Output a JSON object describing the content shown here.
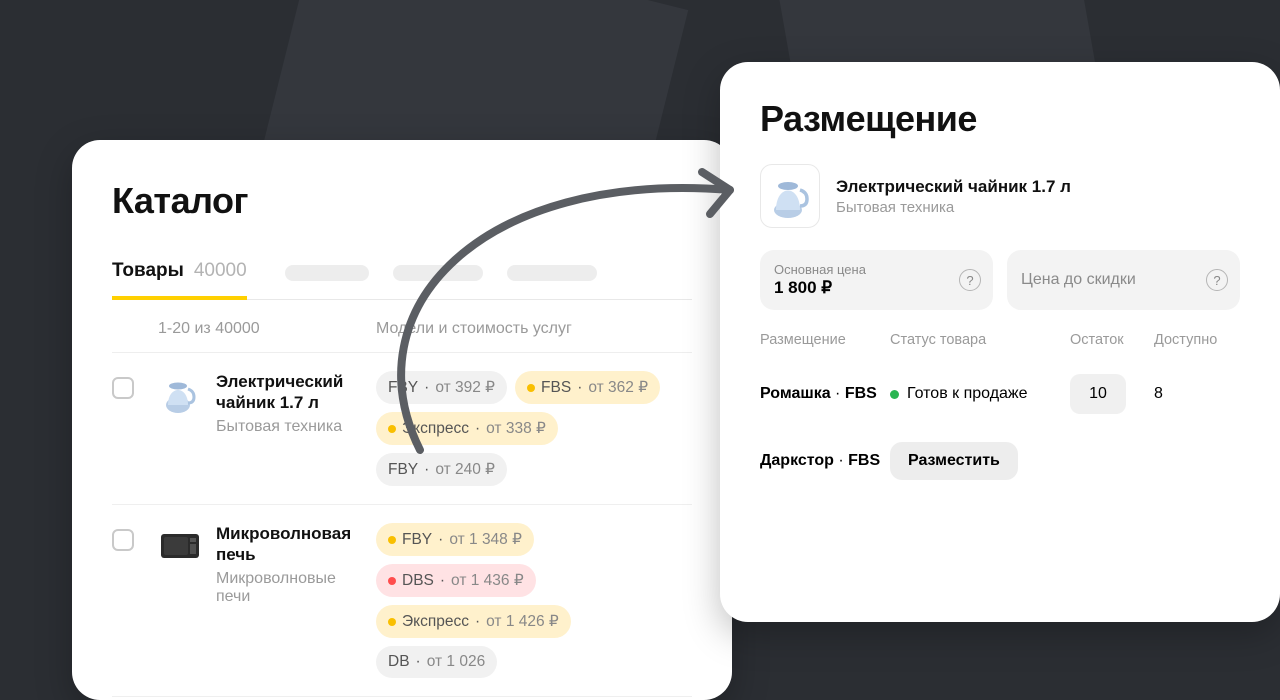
{
  "catalog": {
    "title": "Каталог",
    "tab_label": "Товары",
    "tab_count": "40000",
    "pagination_label": "1-20 из 40000",
    "col_models": "Модели и стоимость услуг",
    "items": [
      {
        "name": "Электрический чайник 1.7 л",
        "category": "Бытовая техника",
        "chips": [
          {
            "label": "FBY",
            "suffix": "от 392 ₽",
            "variant": "grey"
          },
          {
            "label": "FBS",
            "suffix": "от 362 ₽",
            "variant": "yellow"
          },
          {
            "label": "Экспресс",
            "suffix": "от 338 ₽",
            "variant": "yellow"
          },
          {
            "label": "FBY",
            "suffix": "от 240 ₽",
            "variant": "grey"
          }
        ]
      },
      {
        "name": "Микроволновая печь",
        "category": "Микроволновые печи",
        "chips": [
          {
            "label": "FBY",
            "suffix": "от 1 348 ₽",
            "variant": "yellow"
          },
          {
            "label": "DBS",
            "suffix": "от 1 436 ₽",
            "variant": "pink"
          },
          {
            "label": "Экспресс",
            "suffix": "от 1 426 ₽",
            "variant": "yellow"
          },
          {
            "label": "DB",
            "suffix": "от 1 026",
            "variant": "grey"
          }
        ]
      }
    ]
  },
  "placement": {
    "title": "Размещение",
    "product_name": "Электрический чайник 1.7 л",
    "product_category": "Бытовая техника",
    "price_main_label": "Основная цена",
    "price_main_value": "1 800 ₽",
    "price_discount_placeholder": "Цена до скидки",
    "cols": {
      "placement": "Размещение",
      "status": "Статус товара",
      "stock": "Остаток",
      "available": "Доступно"
    },
    "rows": [
      {
        "warehouse": "Ромашка",
        "model": "FBS",
        "status": "Готов к продаже",
        "stock": "10",
        "available": "8"
      },
      {
        "warehouse": "Даркстор",
        "model": "FBS",
        "button": "Разместить"
      }
    ]
  }
}
